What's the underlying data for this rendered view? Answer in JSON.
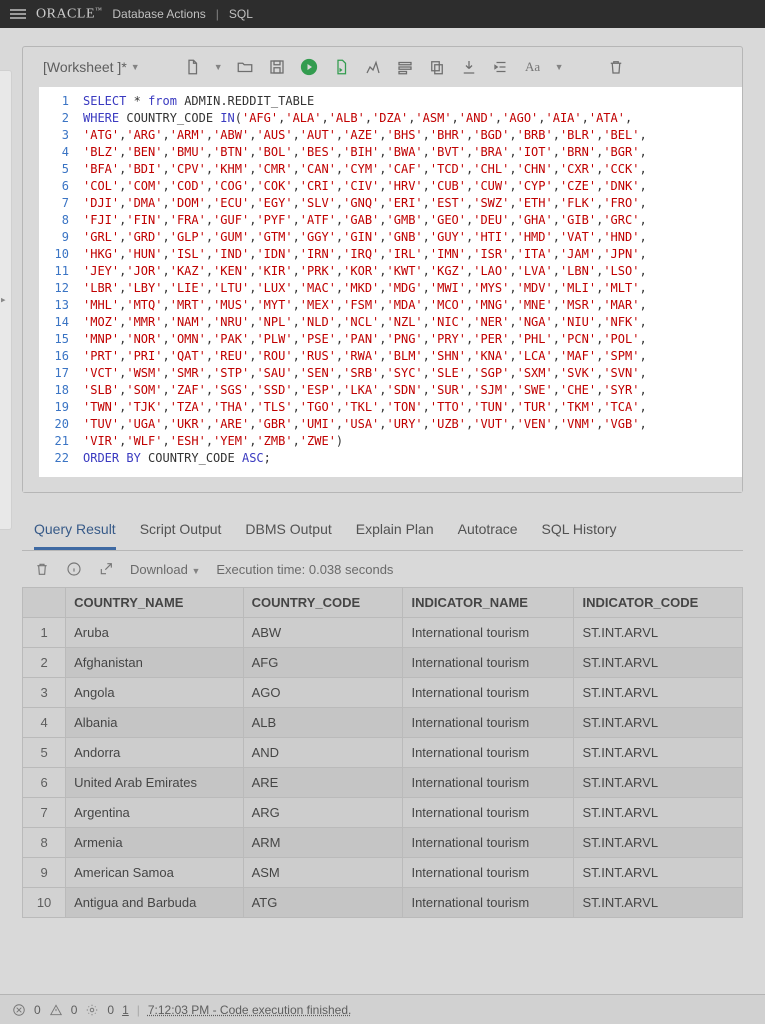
{
  "header": {
    "brand": "ORACLE",
    "product": "Database Actions",
    "section": "SQL"
  },
  "worksheet": {
    "title": "[Worksheet ]*"
  },
  "sql": {
    "keyword_select": "SELECT",
    "keyword_from": "from",
    "table": "ADMIN.REDDIT_TABLE",
    "keyword_where": "WHERE",
    "where_col": "COUNTRY_CODE",
    "keyword_in": "IN",
    "codes": [
      [
        "AFG",
        "ALA",
        "ALB",
        "DZA",
        "ASM",
        "AND",
        "AGO",
        "AIA",
        "ATA"
      ],
      [
        "ATG",
        "ARG",
        "ARM",
        "ABW",
        "AUS",
        "AUT",
        "AZE",
        "BHS",
        "BHR",
        "BGD",
        "BRB",
        "BLR",
        "BEL"
      ],
      [
        "BLZ",
        "BEN",
        "BMU",
        "BTN",
        "BOL",
        "BES",
        "BIH",
        "BWA",
        "BVT",
        "BRA",
        "IOT",
        "BRN",
        "BGR"
      ],
      [
        "BFA",
        "BDI",
        "CPV",
        "KHM",
        "CMR",
        "CAN",
        "CYM",
        "CAF",
        "TCD",
        "CHL",
        "CHN",
        "CXR",
        "CCK"
      ],
      [
        "COL",
        "COM",
        "COD",
        "COG",
        "COK",
        "CRI",
        "CIV",
        "HRV",
        "CUB",
        "CUW",
        "CYP",
        "CZE",
        "DNK"
      ],
      [
        "DJI",
        "DMA",
        "DOM",
        "ECU",
        "EGY",
        "SLV",
        "GNQ",
        "ERI",
        "EST",
        "SWZ",
        "ETH",
        "FLK",
        "FRO"
      ],
      [
        "FJI",
        "FIN",
        "FRA",
        "GUF",
        "PYF",
        "ATF",
        "GAB",
        "GMB",
        "GEO",
        "DEU",
        "GHA",
        "GIB",
        "GRC"
      ],
      [
        "GRL",
        "GRD",
        "GLP",
        "GUM",
        "GTM",
        "GGY",
        "GIN",
        "GNB",
        "GUY",
        "HTI",
        "HMD",
        "VAT",
        "HND"
      ],
      [
        "HKG",
        "HUN",
        "ISL",
        "IND",
        "IDN",
        "IRN",
        "IRQ",
        "IRL",
        "IMN",
        "ISR",
        "ITA",
        "JAM",
        "JPN"
      ],
      [
        "JEY",
        "JOR",
        "KAZ",
        "KEN",
        "KIR",
        "PRK",
        "KOR",
        "KWT",
        "KGZ",
        "LAO",
        "LVA",
        "LBN",
        "LSO"
      ],
      [
        "LBR",
        "LBY",
        "LIE",
        "LTU",
        "LUX",
        "MAC",
        "MKD",
        "MDG",
        "MWI",
        "MYS",
        "MDV",
        "MLI",
        "MLT"
      ],
      [
        "MHL",
        "MTQ",
        "MRT",
        "MUS",
        "MYT",
        "MEX",
        "FSM",
        "MDA",
        "MCO",
        "MNG",
        "MNE",
        "MSR",
        "MAR"
      ],
      [
        "MOZ",
        "MMR",
        "NAM",
        "NRU",
        "NPL",
        "NLD",
        "NCL",
        "NZL",
        "NIC",
        "NER",
        "NGA",
        "NIU",
        "NFK"
      ],
      [
        "MNP",
        "NOR",
        "OMN",
        "PAK",
        "PLW",
        "PSE",
        "PAN",
        "PNG",
        "PRY",
        "PER",
        "PHL",
        "PCN",
        "POL"
      ],
      [
        "PRT",
        "PRI",
        "QAT",
        "REU",
        "ROU",
        "RUS",
        "RWA",
        "BLM",
        "SHN",
        "KNA",
        "LCA",
        "MAF",
        "SPM"
      ],
      [
        "VCT",
        "WSM",
        "SMR",
        "STP",
        "SAU",
        "SEN",
        "SRB",
        "SYC",
        "SLE",
        "SGP",
        "SXM",
        "SVK",
        "SVN"
      ],
      [
        "SLB",
        "SOM",
        "ZAF",
        "SGS",
        "SSD",
        "ESP",
        "LKA",
        "SDN",
        "SUR",
        "SJM",
        "SWE",
        "CHE",
        "SYR"
      ],
      [
        "TWN",
        "TJK",
        "TZA",
        "THA",
        "TLS",
        "TGO",
        "TKL",
        "TON",
        "TTO",
        "TUN",
        "TUR",
        "TKM",
        "TCA"
      ],
      [
        "TUV",
        "UGA",
        "UKR",
        "ARE",
        "GBR",
        "UMI",
        "USA",
        "URY",
        "UZB",
        "VUT",
        "VEN",
        "VNM",
        "VGB"
      ],
      [
        "VIR",
        "WLF",
        "ESH",
        "YEM",
        "ZMB",
        "ZWE"
      ]
    ],
    "keyword_orderby": "ORDER BY",
    "order_col": "COUNTRY_CODE",
    "keyword_asc": "ASC"
  },
  "result_tabs": {
    "query_result": "Query Result",
    "script_output": "Script Output",
    "dbms_output": "DBMS Output",
    "explain_plan": "Explain Plan",
    "autotrace": "Autotrace",
    "sql_history": "SQL History"
  },
  "result_bar": {
    "download": "Download",
    "exec_time": "Execution time: 0.038 seconds"
  },
  "columns": {
    "country_name": "COUNTRY_NAME",
    "country_code": "COUNTRY_CODE",
    "indicator_name": "INDICATOR_NAME",
    "indicator_code": "INDICATOR_CODE"
  },
  "rows": [
    {
      "n": "1",
      "country_name": "Aruba",
      "country_code": "ABW",
      "indicator_name": "International tourism",
      "indicator_code": "ST.INT.ARVL"
    },
    {
      "n": "2",
      "country_name": "Afghanistan",
      "country_code": "AFG",
      "indicator_name": "International tourism",
      "indicator_code": "ST.INT.ARVL"
    },
    {
      "n": "3",
      "country_name": "Angola",
      "country_code": "AGO",
      "indicator_name": "International tourism",
      "indicator_code": "ST.INT.ARVL"
    },
    {
      "n": "4",
      "country_name": "Albania",
      "country_code": "ALB",
      "indicator_name": "International tourism",
      "indicator_code": "ST.INT.ARVL"
    },
    {
      "n": "5",
      "country_name": "Andorra",
      "country_code": "AND",
      "indicator_name": "International tourism",
      "indicator_code": "ST.INT.ARVL"
    },
    {
      "n": "6",
      "country_name": "United Arab Emirates",
      "country_code": "ARE",
      "indicator_name": "International tourism",
      "indicator_code": "ST.INT.ARVL"
    },
    {
      "n": "7",
      "country_name": "Argentina",
      "country_code": "ARG",
      "indicator_name": "International tourism",
      "indicator_code": "ST.INT.ARVL"
    },
    {
      "n": "8",
      "country_name": "Armenia",
      "country_code": "ARM",
      "indicator_name": "International tourism",
      "indicator_code": "ST.INT.ARVL"
    },
    {
      "n": "9",
      "country_name": "American Samoa",
      "country_code": "ASM",
      "indicator_name": "International tourism",
      "indicator_code": "ST.INT.ARVL"
    },
    {
      "n": "10",
      "country_name": "Antigua and Barbuda",
      "country_code": "ATG",
      "indicator_name": "International tourism",
      "indicator_code": "ST.INT.ARVL"
    }
  ],
  "status": {
    "errors": "0",
    "warnings": "0",
    "settings": "0",
    "tasks": "1",
    "time": "7:12:03 PM",
    "msg": "Code execution finished."
  }
}
